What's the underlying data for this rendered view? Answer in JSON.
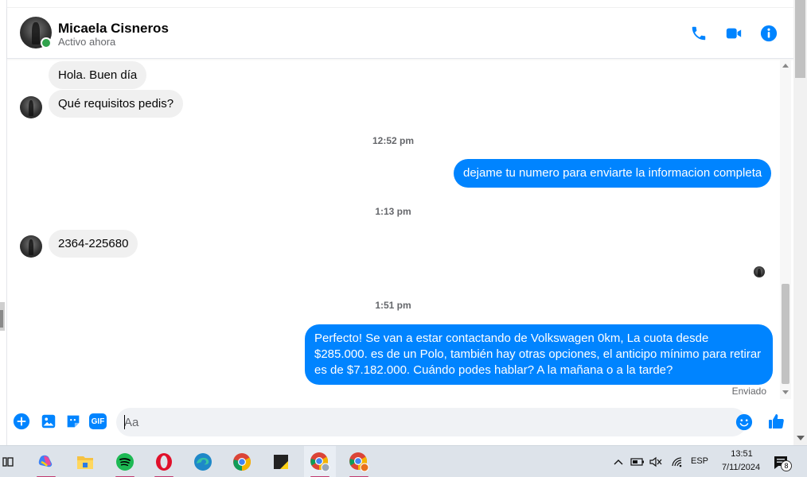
{
  "contact": {
    "name": "Micaela Cisneros",
    "status": "Activo ahora"
  },
  "header_actions": {
    "call_icon": "phone-icon",
    "video_icon": "video-camera-icon",
    "info_icon": "info-icon"
  },
  "messages": [
    {
      "side": "in",
      "text": "Hola.  Buen día"
    },
    {
      "side": "in",
      "text": "Qué requisitos pedis?"
    },
    {
      "type": "time",
      "text": "12:52 pm"
    },
    {
      "side": "out",
      "text": "dejame tu numero para enviarte la informacion completa"
    },
    {
      "type": "time",
      "text": "1:13 pm"
    },
    {
      "side": "in",
      "text": "2364-225680"
    },
    {
      "type": "time",
      "text": "1:51 pm"
    },
    {
      "side": "out",
      "text": "Perfecto!  Se van a estar contactando de Volkswagen 0km, La cuota desde $285.000. es de un Polo, también hay otras opciones, el anticipo mínimo para retirar es de $7.182.000. Cuándo podes hablar? A la mañana o a la tarde?"
    }
  ],
  "delivery_status": "Enviado",
  "composer": {
    "placeholder": "Aa",
    "icons": [
      "plus-icon",
      "image-icon",
      "sticker-icon",
      "gif-icon",
      "emoji-icon",
      "thumbs-up-icon"
    ],
    "gif_label": "GIF"
  },
  "taskbar": {
    "apps": [
      "task-view",
      "copilot",
      "file-explorer",
      "spotify",
      "opera",
      "edge",
      "chrome",
      "sticky-notes",
      "chrome-profile-1",
      "chrome-profile-2"
    ],
    "language": "ESP",
    "time": "13:51",
    "date": "7/11/2024",
    "notification_count": "8"
  },
  "colors": {
    "accent": "#0084ff",
    "incoming_bubble": "#f0f0f0",
    "online": "#31a24c"
  }
}
